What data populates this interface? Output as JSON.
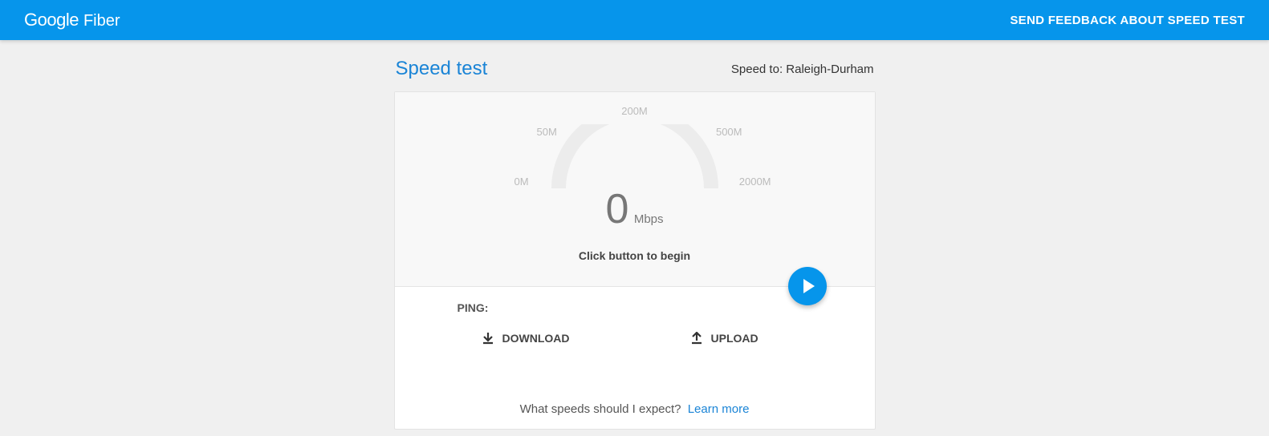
{
  "header": {
    "logo_main": "Google",
    "logo_sub": "Fiber",
    "feedback": "SEND FEEDBACK ABOUT SPEED TEST"
  },
  "page": {
    "title": "Speed test",
    "speed_to_prefix": "Speed to: ",
    "location": "Raleigh-Durham"
  },
  "gauge": {
    "ticks": {
      "t0": "0M",
      "t50": "50M",
      "t200": "200M",
      "t500": "500M",
      "t2000": "2000M"
    },
    "value": "0",
    "unit": "Mbps",
    "instruction": "Click button to begin"
  },
  "metrics": {
    "ping_label": "PING:",
    "download_label": "DOWNLOAD",
    "upload_label": "UPLOAD"
  },
  "footer": {
    "question": "What speeds should I expect?",
    "learn_more": "Learn more"
  }
}
